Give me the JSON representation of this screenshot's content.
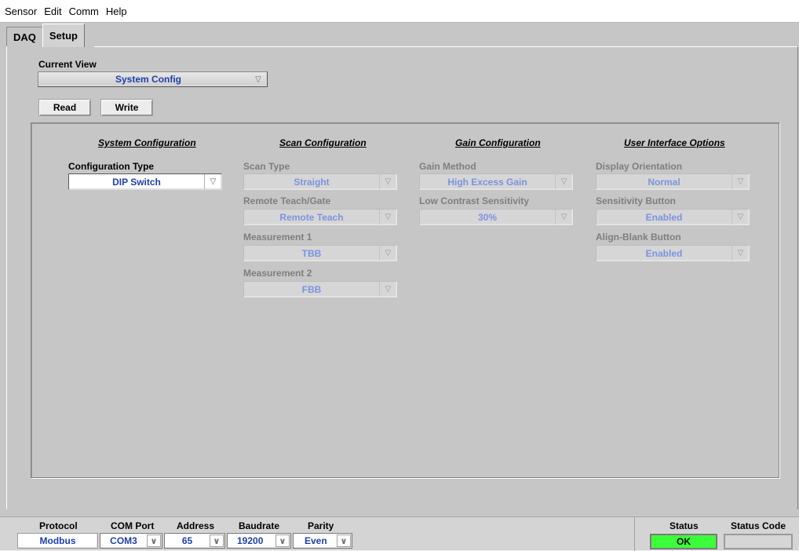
{
  "menu": {
    "items": [
      "Sensor",
      "Edit",
      "Comm",
      "Help"
    ]
  },
  "tabs": [
    {
      "label": "DAQ",
      "active": false
    },
    {
      "label": "Setup",
      "active": true
    }
  ],
  "current_view": {
    "label": "Current View",
    "value": "System Config"
  },
  "buttons": {
    "read": "Read",
    "write": "Write"
  },
  "sections": {
    "system": {
      "title": "System Configuration",
      "config_type_label": "Configuration Type",
      "config_type_value": "DIP Switch"
    },
    "scan": {
      "title": "Scan Configuration",
      "scan_type_label": "Scan Type",
      "scan_type_value": "Straight",
      "remote_label": "Remote Teach/Gate",
      "remote_value": "Remote Teach",
      "meas1_label": "Measurement 1",
      "meas1_value": "TBB",
      "meas2_label": "Measurement 2",
      "meas2_value": "FBB"
    },
    "gain": {
      "title": "Gain Configuration",
      "method_label": "Gain Method",
      "method_value": "High Excess Gain",
      "contrast_label": "Low Contrast Sensitivity",
      "contrast_value": "30%"
    },
    "ui": {
      "title": "User Interface Options",
      "orientation_label": "Display Orientation",
      "orientation_value": "Normal",
      "sensitivity_label": "Sensitivity Button",
      "sensitivity_value": "Enabled",
      "align_label": "Align-Blank Button",
      "align_value": "Enabled"
    }
  },
  "comm": {
    "protocol_label": "Protocol",
    "protocol_value": "Modbus",
    "comport_label": "COM Port",
    "comport_value": "COM3",
    "address_label": "Address",
    "address_value": "65",
    "baudrate_label": "Baudrate",
    "baudrate_value": "19200",
    "parity_label": "Parity",
    "parity_value": "Even"
  },
  "status": {
    "status_label": "Status",
    "status_value": "OK",
    "code_label": "Status Code",
    "code_value": ""
  },
  "colors": {
    "value_text": "#1e3fae",
    "status_ok": "#3cff3c"
  },
  "icons": {
    "dropdown": "triangle-down-icon",
    "combo": "chevron-down-icon"
  }
}
